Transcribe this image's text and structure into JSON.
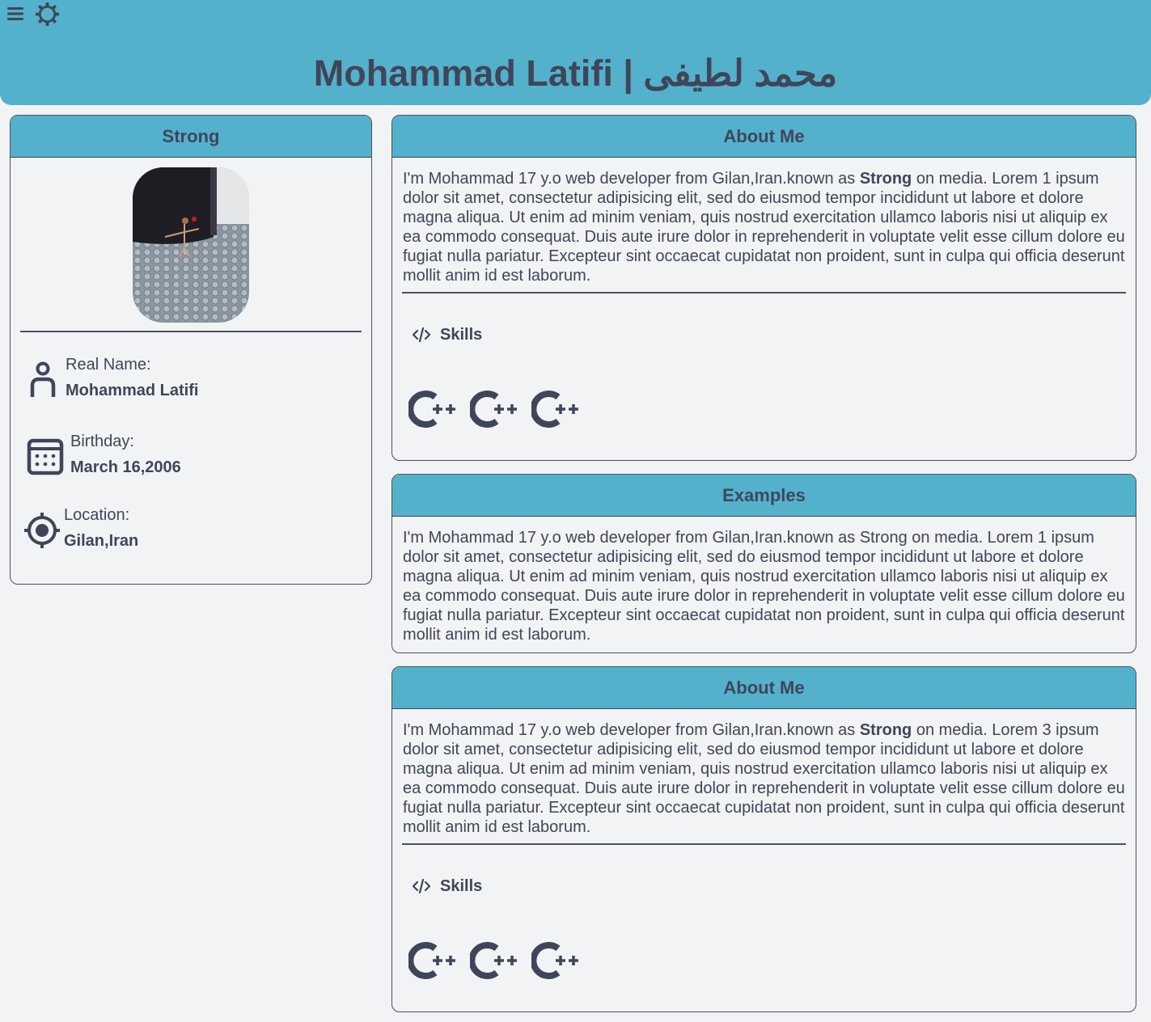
{
  "header": {
    "title": "Mohammad Latifi | محمد لطیفی"
  },
  "profile": {
    "nickname": "Strong",
    "avatar_alt": "profile-photo",
    "real_name_label": "Real Name:",
    "real_name": "Mohammad Latifi",
    "birthday_label": "Birthday:",
    "birthday": "March 16,2006",
    "location_label": "Location:",
    "location": "Gilan,Iran"
  },
  "about1": {
    "title": "About Me",
    "text_before": "I'm Mohammad 17 y.o web developer from Gilan,Iran.known as ",
    "bold": "Strong",
    "text_after": " on media. Lorem 1 ipsum dolor sit amet, consectetur adipisicing elit, sed do eiusmod tempor incididunt ut labore et dolore magna aliqua. Ut enim ad minim veniam, quis nostrud exercitation ullamco laboris nisi ut aliquip ex ea commodo consequat. Duis aute irure dolor in reprehenderit in voluptate velit esse cillum dolore eu fugiat nulla pariatur. Excepteur sint occaecat cupidatat non proident, sunt in culpa qui officia deserunt mollit anim id est laborum.",
    "skills_label": "Skills",
    "skills": [
      "C++",
      "C++",
      "C++"
    ]
  },
  "examples": {
    "title": "Examples",
    "text": "I'm Mohammad 17 y.o web developer from Gilan,Iran.known as Strong on media. Lorem 1 ipsum dolor sit amet, consectetur adipisicing elit, sed do eiusmod tempor incididunt ut labore et dolore magna aliqua. Ut enim ad minim veniam, quis nostrud exercitation ullamco laboris nisi ut aliquip ex ea commodo consequat. Duis aute irure dolor in reprehenderit in voluptate velit esse cillum dolore eu fugiat nulla pariatur. Excepteur sint occaecat cupidatat non proident, sunt in culpa qui officia deserunt mollit anim id est laborum."
  },
  "about2": {
    "title": "About Me",
    "text_before": "I'm Mohammad 17 y.o web developer from Gilan,Iran.known as ",
    "bold": "Strong",
    "text_after": " on media. Lorem 3 ipsum dolor sit amet, consectetur adipisicing elit, sed do eiusmod tempor incididunt ut labore et dolore magna aliqua. Ut enim ad minim veniam, quis nostrud exercitation ullamco laboris nisi ut aliquip ex ea commodo consequat. Duis aute irure dolor in reprehenderit in voluptate velit esse cillum dolore eu fugiat nulla pariatur. Excepteur sint occaecat cupidatat non proident, sunt in culpa qui officia deserunt mollit anim id est laborum.",
    "skills_label": "Skills",
    "skills": [
      "C++",
      "C++",
      "C++"
    ]
  },
  "colors": {
    "header_bg": "#53b1cc",
    "text": "#3f4659",
    "page_bg": "#f1f3f5"
  },
  "icons": [
    "menu-icon",
    "gear-icon",
    "person-icon",
    "calendar-icon",
    "location-icon",
    "code-icon",
    "cplusplus-logo"
  ]
}
